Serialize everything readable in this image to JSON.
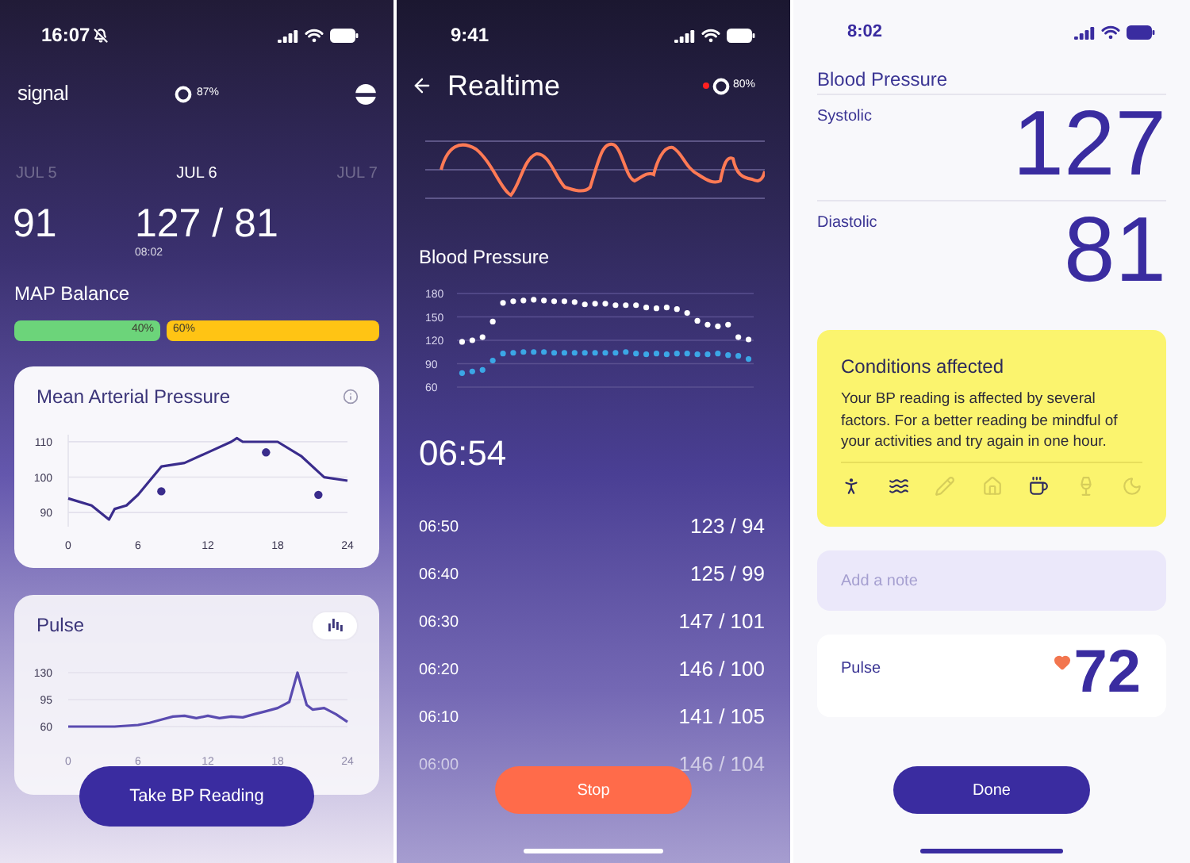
{
  "overview_screen": {
    "status_bar": {
      "time": "16:07"
    },
    "header": {
      "logo": "signal",
      "ring_reading": "87%"
    },
    "dates": [
      {
        "label": "JUL 5",
        "selected": false
      },
      {
        "label": "JUL 6",
        "selected": true
      },
      {
        "label": "JUL 7",
        "selected": false
      }
    ],
    "readings": [
      {
        "value": "91"
      },
      {
        "value": "127 / 81",
        "time": "08:02"
      }
    ],
    "map_balance": {
      "label": "MAP Balance",
      "segments": [
        {
          "text": "40%",
          "color": "#6cd47a"
        },
        {
          "text": "60%",
          "color": "#ffc414"
        }
      ]
    },
    "map_card": {
      "title": "Mean Arterial Pressure",
      "chart_data": {
        "type": "line",
        "grid": true,
        "x": [
          0,
          2,
          3.5,
          4,
          5,
          6,
          8,
          10,
          12,
          14,
          14.5,
          15,
          18,
          20,
          22,
          24
        ],
        "xlim": [
          0,
          24
        ],
        "xticks": [
          0,
          6,
          12,
          18,
          24
        ],
        "ylim": [
          86,
          112
        ],
        "yticks": [
          90,
          100,
          110
        ],
        "series": [
          {
            "color": "#3a2c8c",
            "values": [
              94,
              92,
              88,
              91,
              92,
              95,
              103,
              104,
              107,
              110,
              111,
              110,
              110,
              106,
              100,
              99
            ]
          }
        ]
      }
    },
    "pulse_card": {
      "title": "Pulse",
      "chart_data": {
        "type": "line",
        "grid": true,
        "x": [
          0,
          1,
          2,
          3,
          4,
          5,
          6,
          7,
          8,
          9,
          10,
          11,
          12,
          13,
          14,
          15,
          16,
          17,
          18,
          19,
          19.7,
          20.5,
          21,
          22,
          23,
          24
        ],
        "xlim": [
          0,
          24
        ],
        "xticks": [
          0,
          6,
          12,
          18,
          24
        ],
        "ylim": [
          60,
          130
        ],
        "yticks": [
          60,
          95,
          130
        ],
        "series": [
          {
            "color": "#5a4bb0",
            "values": [
              60,
              60,
              60,
              60,
              60,
              61,
              62,
              65,
              69,
              73,
              74,
              71,
              74,
              71,
              73,
              72,
              76,
              80,
              84,
              92,
              130,
              88,
              82,
              84,
              76,
              66
            ]
          }
        ]
      }
    },
    "primary_button": "Take BP Reading"
  },
  "realtime_screen": {
    "status_bar": {
      "time": "9:41"
    },
    "title": "Realtime",
    "ring_reading": "80%",
    "bp_title": "Blood Pressure",
    "bp_chart": {
      "chart_data": {
        "type": "scatter",
        "grid": true,
        "ylim": [
          60,
          180
        ],
        "yticks": [
          180,
          150,
          120,
          90,
          60
        ],
        "series": [
          {
            "color": "#ffffff",
            "values": [
              118,
              120,
              124,
              144,
              168,
              170,
              171,
              172,
              171,
              170,
              170,
              169,
              166,
              167,
              167,
              165,
              165,
              165,
              162,
              161,
              162,
              160,
              155,
              145,
              140,
              138,
              140,
              124,
              121
            ]
          },
          {
            "color": "#3ba7e6",
            "values": [
              78,
              80,
              82,
              94,
              103,
              104,
              105,
              105,
              105,
              104,
              104,
              104,
              104,
              104,
              104,
              104,
              105,
              103,
              102,
              103,
              102,
              103,
              103,
              102,
              102,
              103,
              101,
              100,
              96
            ]
          }
        ]
      }
    },
    "elapsed": "06:54",
    "rows": [
      {
        "time": "06:50",
        "reading": "123 / 94"
      },
      {
        "time": "06:40",
        "reading": "125 / 99"
      },
      {
        "time": "06:30",
        "reading": "147 / 101"
      },
      {
        "time": "06:20",
        "reading": "146 / 100"
      },
      {
        "time": "06:10",
        "reading": "141 / 105"
      },
      {
        "time": "06:00",
        "reading": "146 / 104"
      }
    ],
    "stop_button": "Stop"
  },
  "result_screen": {
    "status_bar": {
      "time": "8:02"
    },
    "title": "Blood Pressure",
    "measures": [
      {
        "label": "Systolic",
        "value": "127"
      },
      {
        "label": "Diastolic",
        "value": "81"
      }
    ],
    "conditions": {
      "title": "Conditions affected",
      "text": "Your BP reading is affected by several factors. For a better reading be mindful of your activities and try again in one hour.",
      "icons": [
        {
          "kind": "exercise",
          "on": true
        },
        {
          "kind": "waves",
          "on": true
        },
        {
          "kind": "pencil",
          "on": false
        },
        {
          "kind": "home",
          "on": false
        },
        {
          "kind": "coffee",
          "on": true
        },
        {
          "kind": "wine",
          "on": false
        },
        {
          "kind": "moon",
          "on": false
        }
      ]
    },
    "note": {
      "placeholder": "Add a note"
    },
    "pulse": {
      "label": "Pulse",
      "value": "72"
    },
    "done_button": "Done"
  }
}
